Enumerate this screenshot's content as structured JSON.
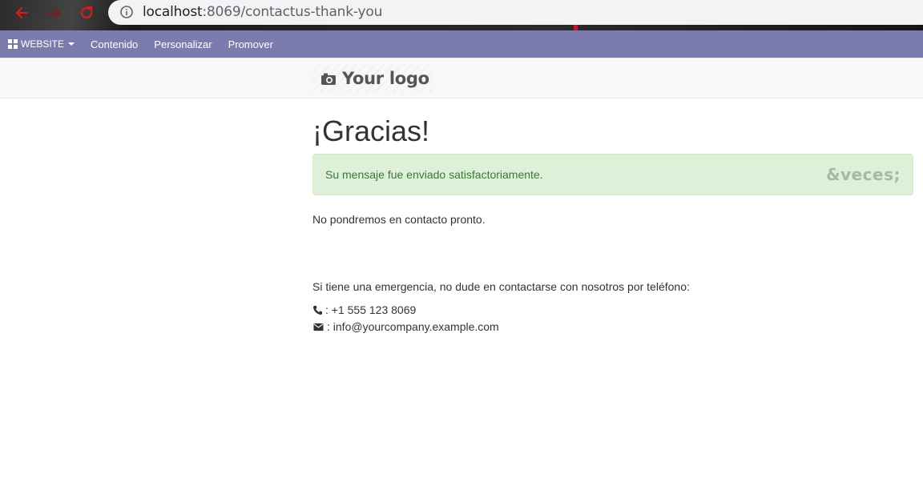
{
  "browser": {
    "url_host": "localhost",
    "url_rest": ":8069/contactus-thank-you",
    "icons": [
      "back-arrow-icon",
      "forward-arrow-icon",
      "reload-icon",
      "info-icon"
    ]
  },
  "admin_bar": {
    "website_label": "WEBSITE",
    "menu": [
      "Contenido",
      "Personalizar",
      "Promover"
    ],
    "bg_color": "#7c7bad"
  },
  "header": {
    "logo_text": "Your logo"
  },
  "main": {
    "title": "¡Gracias!",
    "alert_message": "Su mensaje fue enviado satisfactoriamente.",
    "alert_close": "&veces;",
    "follow_up": "No pondremos en contacto pronto.",
    "emergency_text": "Si tiene una emergencia, no dude en contactarse con nosotros por teléfono:",
    "phone": ": +1 555 123 8069",
    "email": ": info@yourcompany.example.com"
  },
  "colors": {
    "alert_bg": "#dff0d8",
    "alert_text": "#3c763d"
  }
}
